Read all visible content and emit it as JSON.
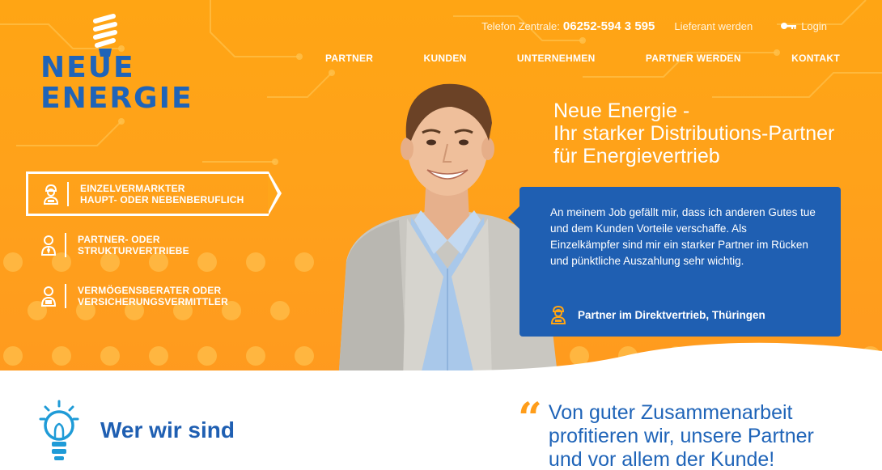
{
  "brand": {
    "logo_line1": "NEUE",
    "logo_line2": "ENERGIE",
    "color_primary": "#1f5fb2",
    "color_accent": "#ffa514"
  },
  "topbar": {
    "phone_label": "Telefon Zentrale:",
    "phone_number": "06252-594 3 595",
    "supplier_link": "Lieferant werden",
    "login_label": "Login",
    "login_icon": "key-icon"
  },
  "nav": {
    "items": [
      {
        "label": "PARTNER"
      },
      {
        "label": "KUNDEN"
      },
      {
        "label": "UNTERNEHMEN"
      },
      {
        "label": "PARTNER WERDEN"
      },
      {
        "label": "KONTAKT"
      }
    ]
  },
  "hero": {
    "headline_line1": "Neue Energie -",
    "headline_line2": "Ihr starker Distributions-Partner",
    "headline_line3": "für Energievertrieb"
  },
  "segments": [
    {
      "line1": "EINZELVERMARKTER",
      "line2": "HAUPT- ODER NEBENBERUFLICH",
      "icon": "person-helmet-icon",
      "active": true
    },
    {
      "line1": "PARTNER- ODER",
      "line2": "STRUKTURVERTRIEBE",
      "icon": "person-tie-icon",
      "active": false
    },
    {
      "line1": "VERMÖGENSBERATER ODER",
      "line2": "VERSICHERUNGSVERMITTLER",
      "icon": "person-briefcase-icon",
      "active": false
    }
  ],
  "testimonial": {
    "quote": "An meinem Job gefällt mir, dass ich anderen Gutes tue und dem Kunden Vorteile verschaffe. Als Einzelkämpfer sind mir ein starker Partner im Rücken und pünktliche Auszahlung sehr wichtig.",
    "author": "Partner im Direktvertrieb, Thüringen"
  },
  "about": {
    "heading": "Wer wir sind",
    "icon": "lightbulb-icon"
  },
  "bottom_quote": {
    "mark": "“",
    "text": "Von guter Zusammenarbeit profitieren wir, unsere Partner und vor allem der Kunde!"
  }
}
